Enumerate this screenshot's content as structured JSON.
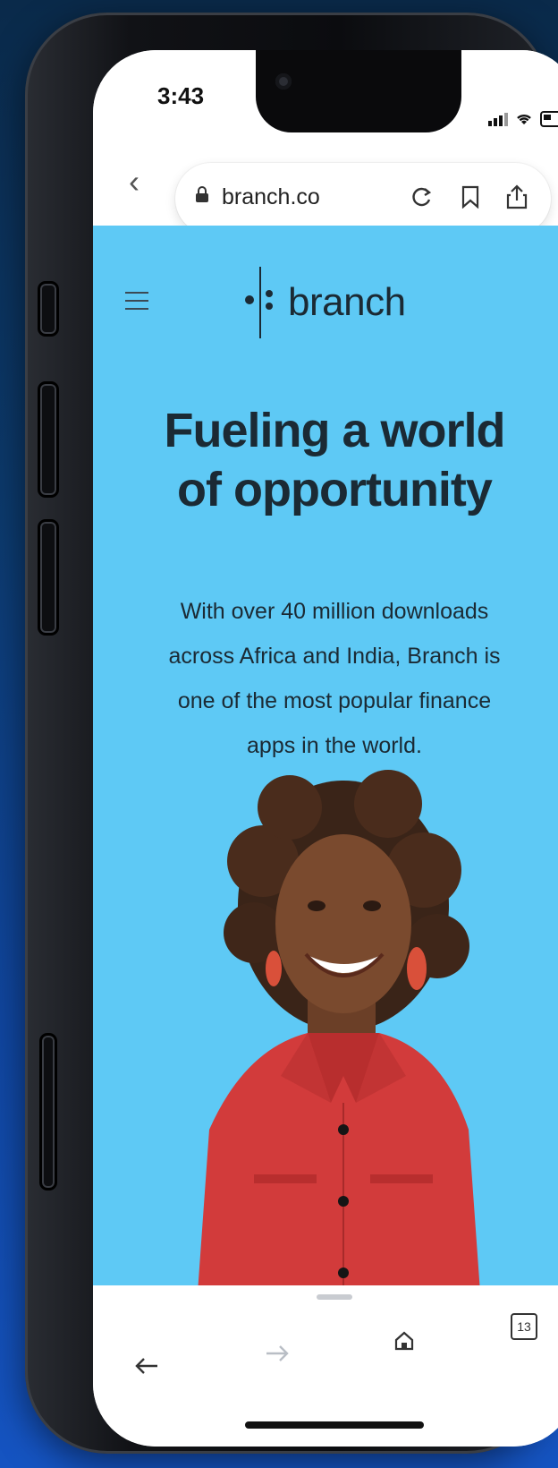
{
  "status_bar": {
    "time": "3:43"
  },
  "browser": {
    "url": "branch.co",
    "back_icon": "chevron-left-icon",
    "lock_icon": "lock-icon",
    "actions": [
      "reload-icon",
      "bookmark-icon",
      "share-icon"
    ],
    "toolbar": {
      "back": "arrow-left-icon",
      "forward": "arrow-right-icon",
      "home": "home-icon",
      "tabs_count": "13"
    }
  },
  "site": {
    "brand": "branch",
    "title_line1": "Fueling a world",
    "title_line2": "of opportunity",
    "subtitle_line1": "With over 40 million downloads",
    "subtitle_line2": "across Africa and India, Branch is",
    "subtitle_line3": "one of the most popular finance",
    "subtitle_line4": "apps in the world.",
    "colors": {
      "hero_background": "#5ec9f5",
      "text": "#1b2a34",
      "accent_shirt": "#d23b3b"
    }
  }
}
